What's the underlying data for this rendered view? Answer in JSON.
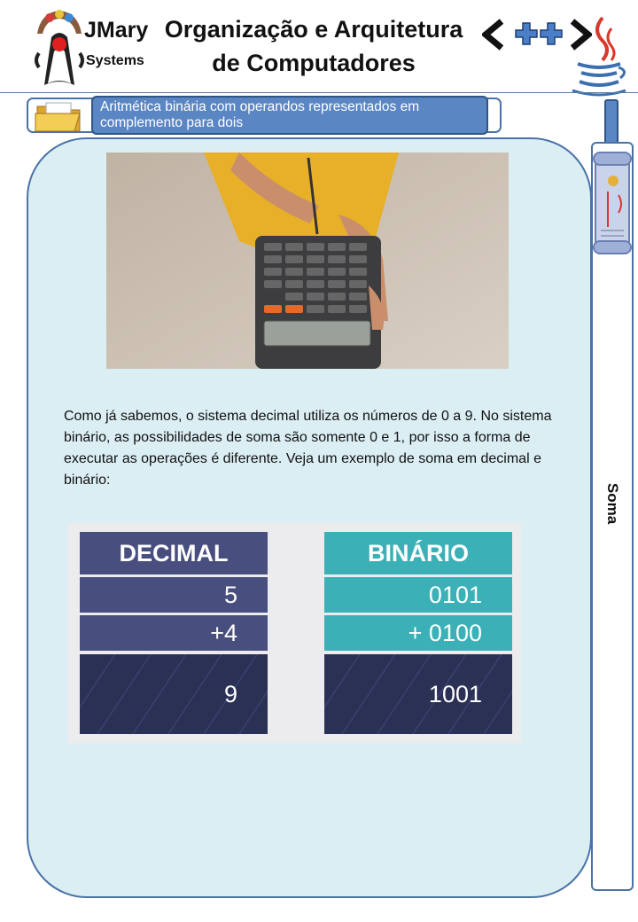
{
  "header": {
    "brand_line1": "JMary",
    "brand_line2": "Systems",
    "title_line1": "Organização e Arquitetura",
    "title_line2": "de Computadores"
  },
  "section": {
    "topic_line1": "Aritmética binária com operandos representados em",
    "topic_line2": "complemento para dois"
  },
  "content": {
    "paragraph": "Como já sabemos, o sistema decimal utiliza os números de 0 a 9. No sistema binário, as possibilidades de soma são somente 0 e 1, por isso a forma de executar as operações é diferente. Veja um exemplo de soma em decimal e binário:"
  },
  "tables": {
    "decimal": {
      "header": "DECIMAL",
      "row1": "5",
      "row2": "+4",
      "result": "9"
    },
    "binary": {
      "header": "BINÁRIO",
      "row1": "0101",
      "row2": "+ 0100",
      "result": "1001"
    }
  },
  "sidebar": {
    "label": "Soma"
  },
  "colors": {
    "panel_bg": "#dbeef4",
    "accent_blue": "#5b86c4",
    "decimal_header": "#484f7e",
    "binary_header": "#3bb1b7",
    "result_bg": "#2b3055"
  },
  "icons": [
    "java-duke-logo",
    "cpp-logo",
    "java-cup-logo",
    "folder-icon",
    "scroll-icon"
  ]
}
